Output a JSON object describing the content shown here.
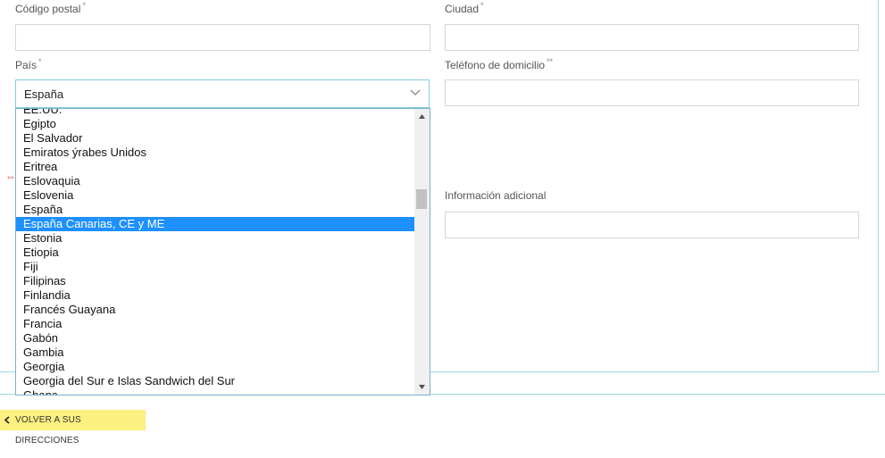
{
  "form": {
    "postal_code_label": "Código postal",
    "city_label": "Ciudad",
    "country_label": "País",
    "home_phone_label": "Teléfono de domicilio",
    "additional_info_label": "Información adicional",
    "required_mark": "*",
    "phone_required_mark": "**",
    "hint_mark": "**",
    "country_selected": "España"
  },
  "dropdown": {
    "options": [
      "EE.UU.",
      "Egipto",
      "El Salvador",
      "Emiratos ýrabes Unidos",
      "Eritrea",
      "Eslovaquia",
      "Eslovenia",
      "España",
      "España Canarias, CE y ME",
      "Estonia",
      "Etiopia",
      "Fiji",
      "Filipinas",
      "Finlandia",
      "Francés Guayana",
      "Francia",
      "Gabón",
      "Gambia",
      "Georgia",
      "Georgia del Sur e Islas Sandwich del Sur",
      "Ghana"
    ],
    "highlighted": "España Canarias, CE y ME"
  },
  "footer": {
    "back_label": "VOLVER A SUS DIRECCIONES"
  },
  "colors": {
    "accent_border": "#7ecfe0",
    "highlight": "#1e90ff",
    "button_bg": "#fbf080"
  }
}
